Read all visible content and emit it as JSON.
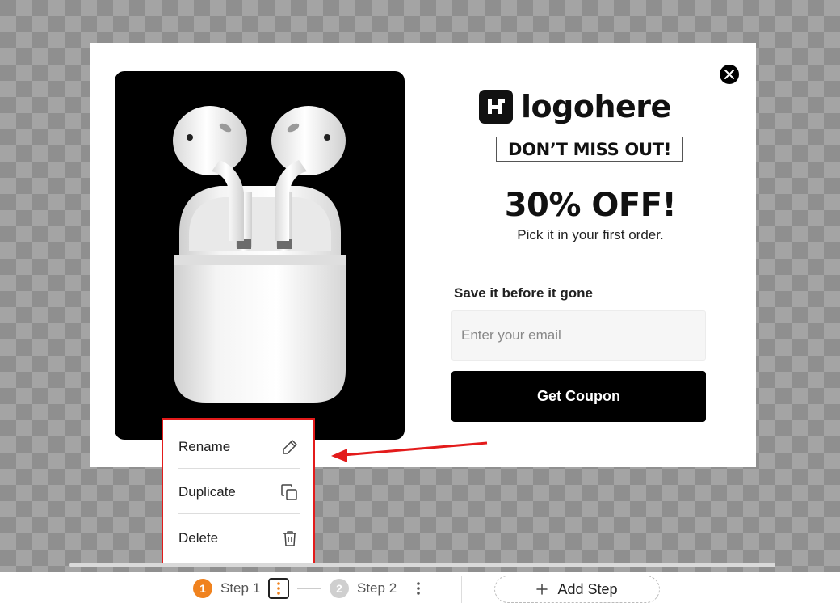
{
  "popup": {
    "close_icon": "close-icon",
    "product_image": "airpods-with-charging-case",
    "logo": {
      "mark": "H",
      "text": "logohere"
    },
    "banner": "DON’T MISS OUT!",
    "headline": "30% OFF!",
    "subline": "Pick it in your first order.",
    "form_label": "Save it before it gone",
    "email_placeholder": "Enter your email",
    "cta_label": "Get Coupon"
  },
  "context_menu": {
    "items": [
      {
        "label": "Rename",
        "icon": "pencil-icon"
      },
      {
        "label": "Duplicate",
        "icon": "copy-icon"
      },
      {
        "label": "Delete",
        "icon": "trash-icon"
      }
    ]
  },
  "steps_bar": {
    "steps": [
      {
        "number": "1",
        "label": "Step 1",
        "active": true
      },
      {
        "number": "2",
        "label": "Step 2",
        "active": false
      }
    ],
    "add_step_label": "Add Step"
  },
  "colors": {
    "accent_orange": "#f0821e",
    "highlight_red": "#e31b1b",
    "inactive_step": "#cfcfcf",
    "cta_background": "#000000"
  }
}
